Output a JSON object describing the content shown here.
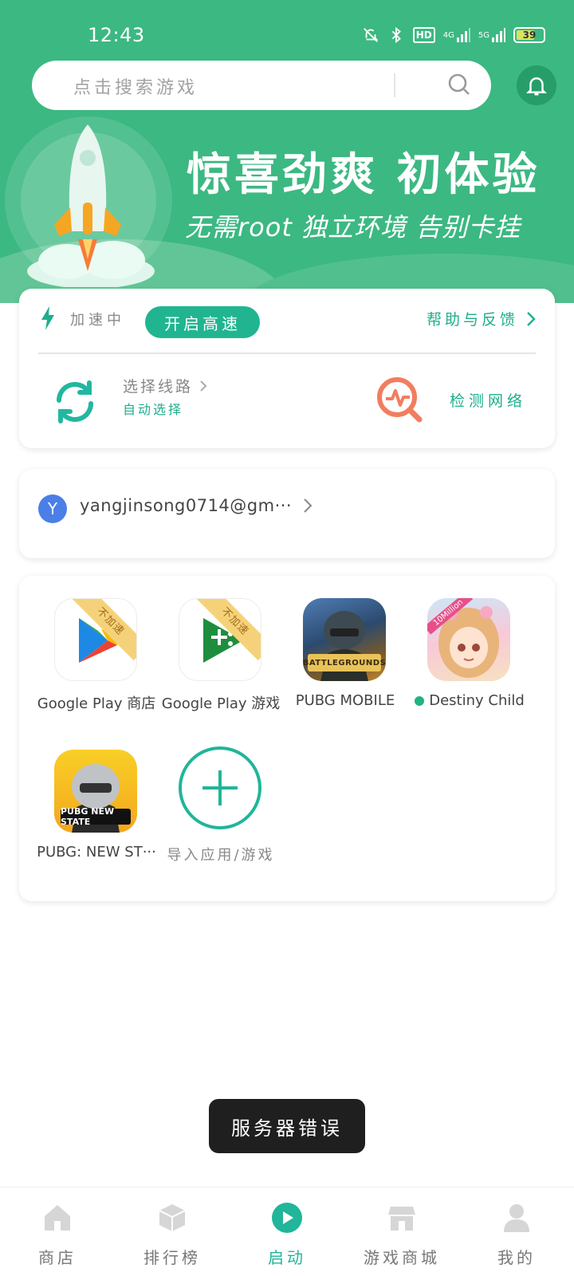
{
  "status": {
    "time": "12:43",
    "battery": "39",
    "hd": "HD",
    "net1": "4G",
    "net2": "5G"
  },
  "search": {
    "placeholder": "点击搜索游戏"
  },
  "banner": {
    "title": "惊喜劲爽  初体验",
    "subtitle": "无需root  独立环境  告别卡挂"
  },
  "accel": {
    "status": "加速中",
    "button": "开启高速",
    "help": "帮助与反馈",
    "route_label": "选择线路",
    "route_value": "自动选择",
    "detect": "检测网络"
  },
  "account": {
    "avatar_letter": "Y",
    "email": "yangjinsong0714@gm···"
  },
  "apps": [
    {
      "label": "Google Play 商店",
      "badge": "不加速"
    },
    {
      "label": "Google Play 游戏",
      "badge": "不加速"
    },
    {
      "label": "PUBG MOBILE",
      "icon_text": "BATTLEGROUNDS"
    },
    {
      "label": "Destiny Child",
      "icon_text": "10Million"
    },
    {
      "label": "PUBG: NEW ST···",
      "icon_text": "PUBG NEW STATE"
    },
    {
      "label": "导入应用/游戏"
    }
  ],
  "toast": "服务器错误",
  "tabs": [
    {
      "label": "商店",
      "icon": "home-icon"
    },
    {
      "label": "排行榜",
      "icon": "cube-icon"
    },
    {
      "label": "启动",
      "icon": "play-icon",
      "active": true
    },
    {
      "label": "游戏商城",
      "icon": "store-icon"
    },
    {
      "label": "我的",
      "icon": "user-icon"
    }
  ],
  "colors": {
    "brand": "#3cb882",
    "accent": "#21b59a",
    "toast": "#1f1f1f"
  }
}
